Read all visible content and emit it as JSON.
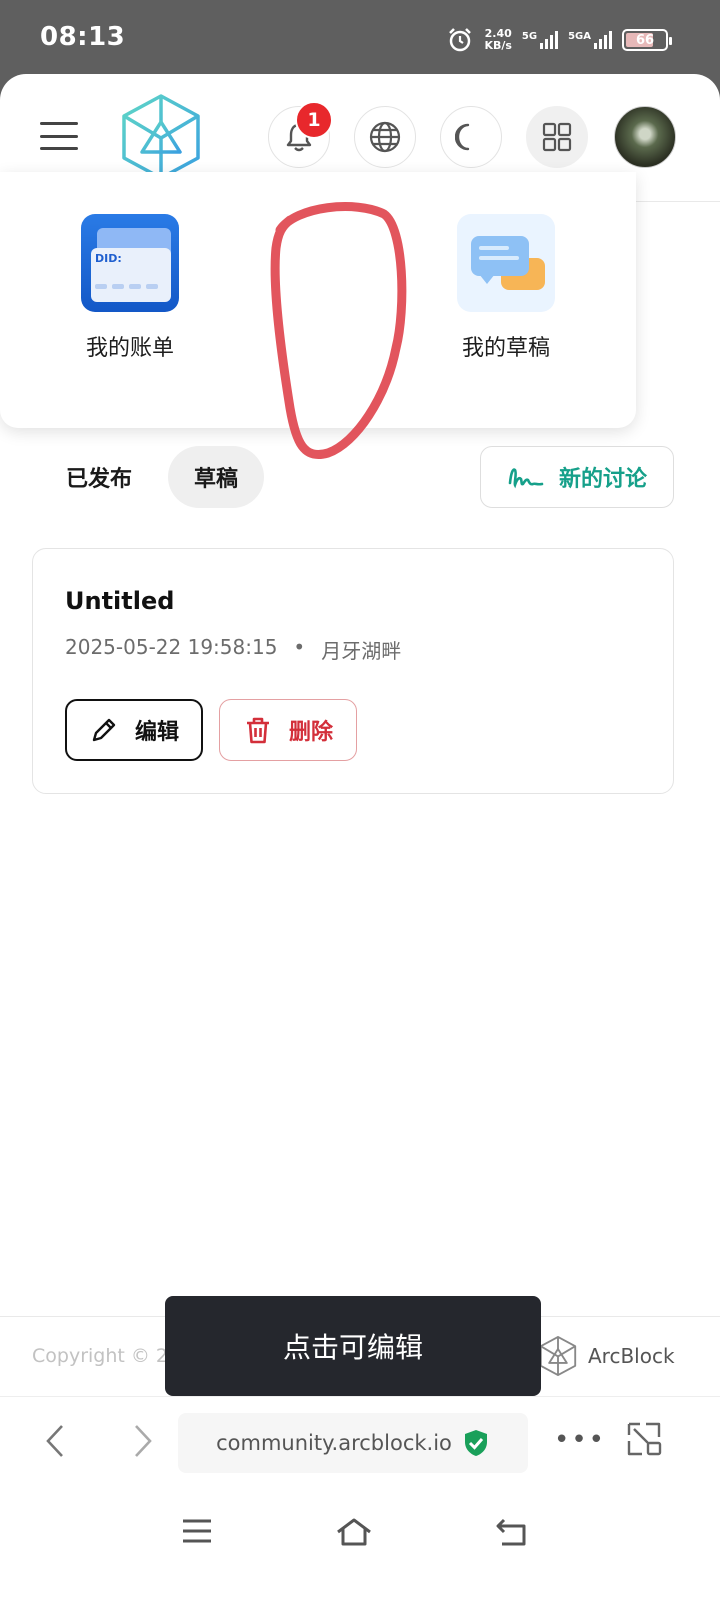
{
  "status_bar": {
    "time": "08:13",
    "speed_value": "2.40",
    "speed_unit": "KB/s",
    "net1": "5G",
    "net2": "5GA",
    "battery": "66"
  },
  "app_bar": {
    "notification_count": "1",
    "icons": [
      "menu-icon",
      "arcblock-logo",
      "bell-icon",
      "globe-icon",
      "moon-icon",
      "grid-icon",
      "avatar"
    ]
  },
  "dropdown": {
    "items": [
      {
        "label": "我的账单",
        "icon": "bill-card-icon",
        "icon_text": "DID:"
      },
      {
        "label": "我的草稿",
        "icon": "chat-bubbles-icon"
      }
    ]
  },
  "tabs": [
    {
      "label": "已发布",
      "active": false
    },
    {
      "label": "草稿",
      "active": true
    }
  ],
  "new_discussion": {
    "label": "新的讨论",
    "color": "#16a08a"
  },
  "draft": {
    "title": "Untitled",
    "timestamp": "2025-05-22 19:58:15",
    "separator": "•",
    "author": "月牙湖畔",
    "edit_label": "编辑",
    "delete_label": "删除"
  },
  "footer": {
    "copyright": "Copyright © 20",
    "brand": "ArcBlock"
  },
  "tooltip": {
    "text": "点击可编辑"
  },
  "browser": {
    "url": "community.arcblock.io"
  },
  "colors": {
    "accent": "#16a08a",
    "danger": "#d32f3a",
    "badge": "#e8282c",
    "annotation": "#e0474f"
  }
}
